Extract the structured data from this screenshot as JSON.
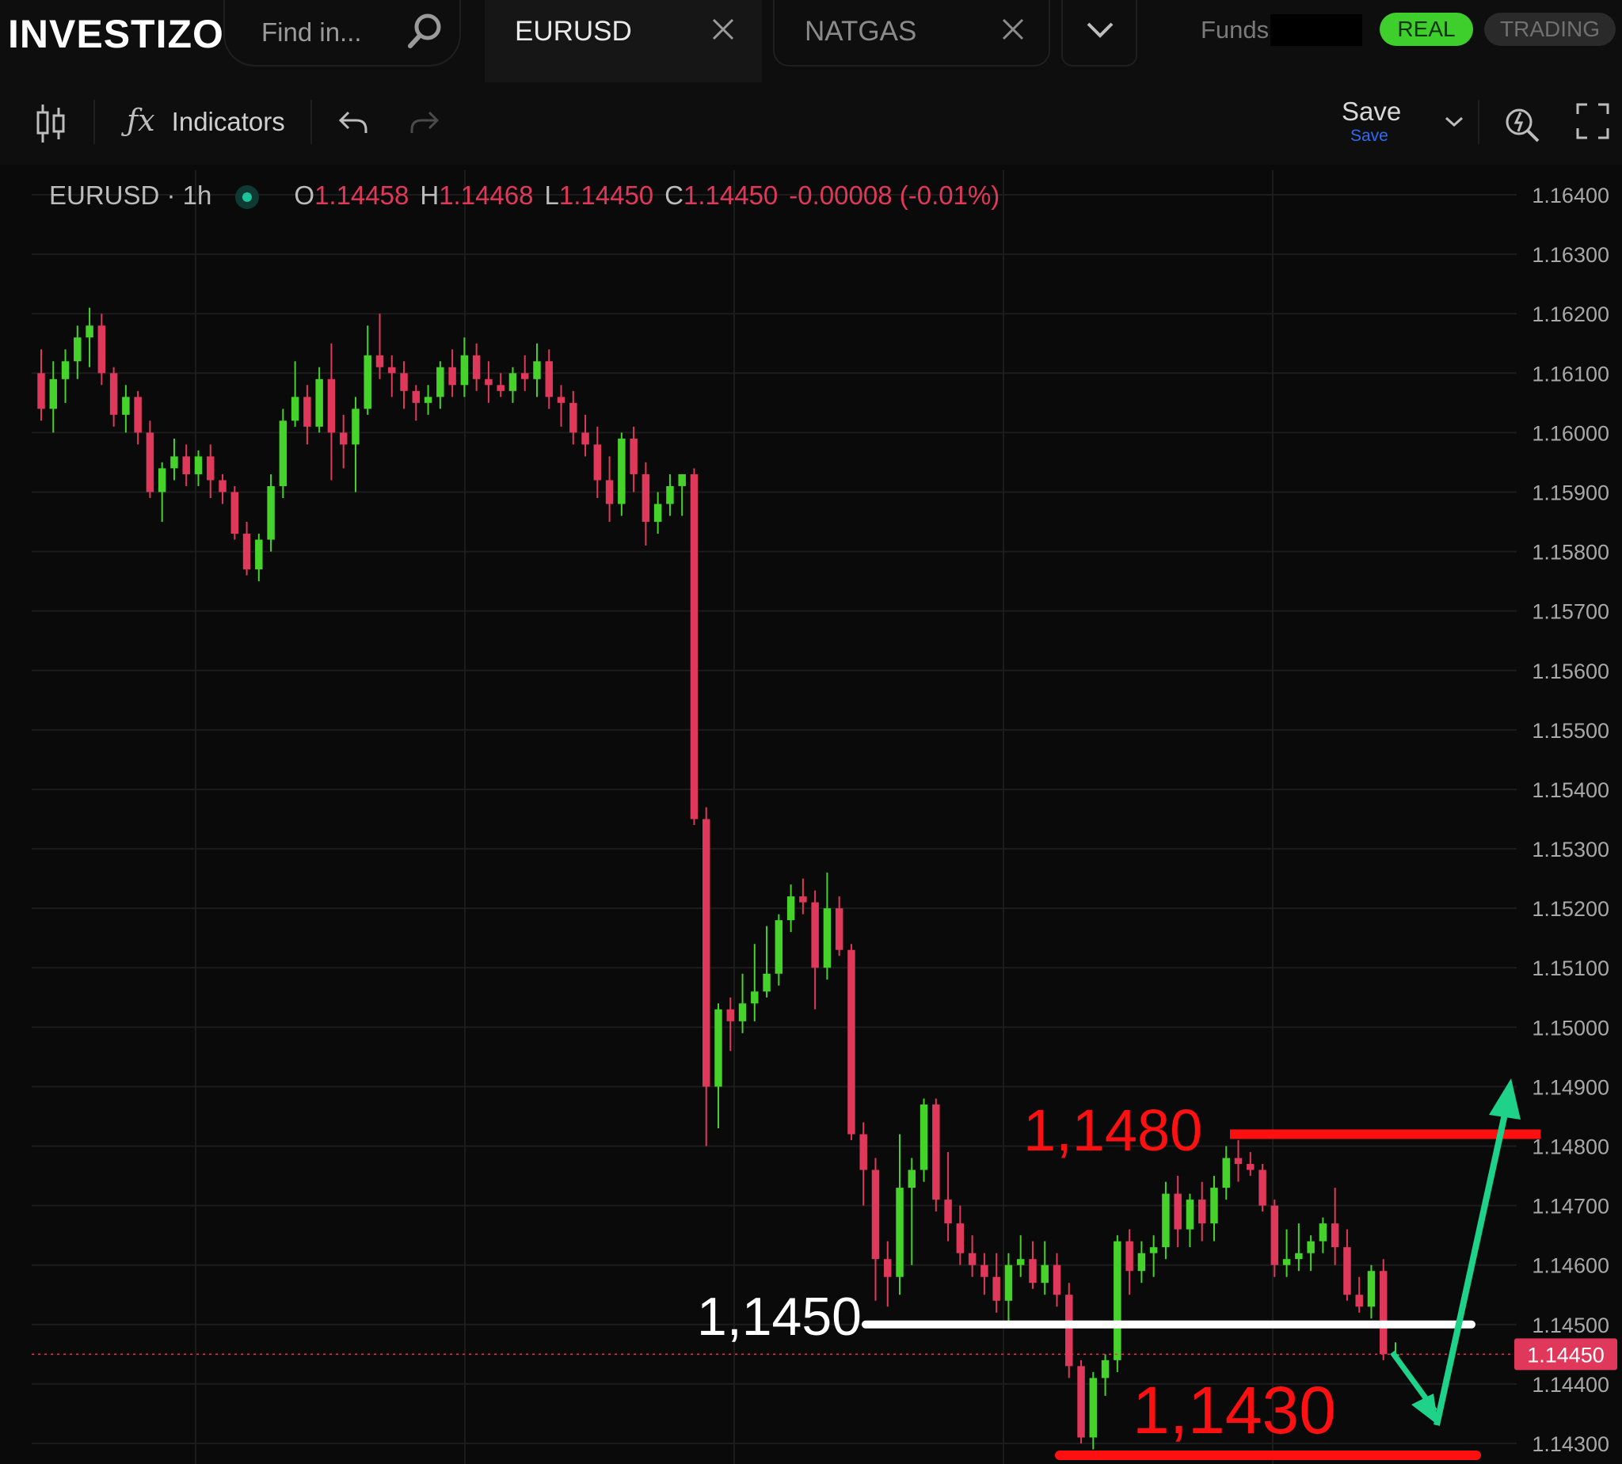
{
  "app": {
    "logo": "INVESTIZO",
    "search_placeholder": "Find in...",
    "tabs": [
      {
        "label": "EURUSD",
        "active": true
      },
      {
        "label": "NATGAS",
        "active": false
      }
    ],
    "funds_label": "Funds:",
    "account_real": "REAL",
    "account_trading": "TRADING"
  },
  "toolbar": {
    "indicators_label": "Indicators",
    "save_label": "Save",
    "save_sublabel": "Save"
  },
  "legend": {
    "symbol": "EURUSD · 1h",
    "o_key": "O",
    "o_val": "1.14458",
    "h_key": "H",
    "h_val": "1.14468",
    "l_key": "L",
    "l_val": "1.14450",
    "c_key": "C",
    "c_val": "1.14450",
    "change": "-0.00008 (-0.01%)"
  },
  "chart_data": {
    "type": "candlestick",
    "symbol": "EURUSD",
    "timeframe": "1h",
    "y_ticks": [
      "1.16400",
      "1.16300",
      "1.16200",
      "1.16100",
      "1.16000",
      "1.15900",
      "1.15800",
      "1.15700",
      "1.15600",
      "1.15500",
      "1.15400",
      "1.15300",
      "1.15200",
      "1.15100",
      "1.15000",
      "1.14900",
      "1.14800",
      "1.14700",
      "1.14600",
      "1.14500",
      "1.14400",
      "1.14300"
    ],
    "ylim": [
      1.1428,
      1.1644
    ],
    "current_price": "1.14450",
    "colors": {
      "up": "#45d22a",
      "down": "#e0385a",
      "annotation_red": "#ff1010",
      "annotation_white": "#ffffff",
      "arrow": "#1fd28a"
    },
    "candles": [
      [
        1.161,
        1.1614,
        1.1602,
        1.1604
      ],
      [
        1.1604,
        1.1612,
        1.16,
        1.1609
      ],
      [
        1.1609,
        1.1614,
        1.1605,
        1.1612
      ],
      [
        1.1612,
        1.1618,
        1.1609,
        1.1616
      ],
      [
        1.1616,
        1.1621,
        1.1611,
        1.1618
      ],
      [
        1.1618,
        1.162,
        1.1608,
        1.161
      ],
      [
        1.161,
        1.1611,
        1.1601,
        1.1603
      ],
      [
        1.1603,
        1.1608,
        1.16,
        1.1606
      ],
      [
        1.1606,
        1.1607,
        1.1598,
        1.16
      ],
      [
        1.16,
        1.1602,
        1.1589,
        1.159
      ],
      [
        1.159,
        1.1595,
        1.1585,
        1.1594
      ],
      [
        1.1594,
        1.1599,
        1.1592,
        1.1596
      ],
      [
        1.1596,
        1.1598,
        1.1591,
        1.1593
      ],
      [
        1.1593,
        1.1597,
        1.1591,
        1.1596
      ],
      [
        1.1596,
        1.1598,
        1.1589,
        1.1592
      ],
      [
        1.1592,
        1.1593,
        1.1588,
        1.159
      ],
      [
        1.159,
        1.1591,
        1.1582,
        1.1583
      ],
      [
        1.1583,
        1.1585,
        1.1576,
        1.1577
      ],
      [
        1.1577,
        1.1583,
        1.1575,
        1.1582
      ],
      [
        1.1582,
        1.1593,
        1.158,
        1.1591
      ],
      [
        1.1591,
        1.1604,
        1.1589,
        1.1602
      ],
      [
        1.1602,
        1.1612,
        1.1601,
        1.1606
      ],
      [
        1.1606,
        1.1608,
        1.1598,
        1.1601
      ],
      [
        1.1601,
        1.1611,
        1.16,
        1.1609
      ],
      [
        1.1609,
        1.1615,
        1.1592,
        1.16
      ],
      [
        1.16,
        1.1603,
        1.1594,
        1.1598
      ],
      [
        1.1598,
        1.1606,
        1.159,
        1.1604
      ],
      [
        1.1604,
        1.1618,
        1.1603,
        1.1613
      ],
      [
        1.1613,
        1.162,
        1.1609,
        1.1611
      ],
      [
        1.1611,
        1.1613,
        1.1606,
        1.161
      ],
      [
        1.161,
        1.1612,
        1.1604,
        1.1607
      ],
      [
        1.1607,
        1.1608,
        1.1602,
        1.1605
      ],
      [
        1.1605,
        1.1608,
        1.1603,
        1.1606
      ],
      [
        1.1606,
        1.1612,
        1.1604,
        1.1611
      ],
      [
        1.1611,
        1.1614,
        1.1606,
        1.1608
      ],
      [
        1.1608,
        1.1616,
        1.1606,
        1.1613
      ],
      [
        1.1613,
        1.1615,
        1.1607,
        1.1609
      ],
      [
        1.1609,
        1.1612,
        1.1605,
        1.1608
      ],
      [
        1.1608,
        1.161,
        1.1606,
        1.1607
      ],
      [
        1.1607,
        1.1611,
        1.1605,
        1.161
      ],
      [
        1.161,
        1.1613,
        1.1607,
        1.1609
      ],
      [
        1.1609,
        1.1615,
        1.1606,
        1.1612
      ],
      [
        1.1612,
        1.1614,
        1.1604,
        1.1606
      ],
      [
        1.1606,
        1.1608,
        1.1601,
        1.1605
      ],
      [
        1.1605,
        1.1607,
        1.1598,
        1.16
      ],
      [
        1.16,
        1.1603,
        1.1596,
        1.1598
      ],
      [
        1.1598,
        1.1601,
        1.1589,
        1.1592
      ],
      [
        1.1592,
        1.1596,
        1.1585,
        1.1588
      ],
      [
        1.1588,
        1.16,
        1.1586,
        1.1599
      ],
      [
        1.1599,
        1.1601,
        1.159,
        1.1593
      ],
      [
        1.1593,
        1.1595,
        1.1581,
        1.1585
      ],
      [
        1.1585,
        1.159,
        1.1583,
        1.1588
      ],
      [
        1.1588,
        1.1593,
        1.1586,
        1.1591
      ],
      [
        1.1591,
        1.1593,
        1.1586,
        1.1593
      ],
      [
        1.1593,
        1.1594,
        1.1534,
        1.1535
      ],
      [
        1.1535,
        1.1537,
        1.148,
        1.149
      ],
      [
        1.149,
        1.1504,
        1.1483,
        1.1503
      ],
      [
        1.1503,
        1.1505,
        1.1496,
        1.1501
      ],
      [
        1.1501,
        1.1509,
        1.1499,
        1.1504
      ],
      [
        1.1504,
        1.1514,
        1.1501,
        1.1506
      ],
      [
        1.1506,
        1.1517,
        1.1505,
        1.1509
      ],
      [
        1.1509,
        1.1519,
        1.1507,
        1.1518
      ],
      [
        1.1518,
        1.1524,
        1.1516,
        1.1522
      ],
      [
        1.1522,
        1.1525,
        1.1519,
        1.1521
      ],
      [
        1.1521,
        1.1523,
        1.1503,
        1.151
      ],
      [
        1.151,
        1.1526,
        1.1508,
        1.152
      ],
      [
        1.152,
        1.1522,
        1.1512,
        1.1513
      ],
      [
        1.1513,
        1.1514,
        1.1481,
        1.1482
      ],
      [
        1.1482,
        1.1484,
        1.147,
        1.1476
      ],
      [
        1.1476,
        1.1478,
        1.1454,
        1.1461
      ],
      [
        1.1461,
        1.1464,
        1.1453,
        1.1458
      ],
      [
        1.1458,
        1.1482,
        1.1455,
        1.1473
      ],
      [
        1.1473,
        1.1478,
        1.146,
        1.1476
      ],
      [
        1.1476,
        1.1488,
        1.1474,
        1.1487
      ],
      [
        1.1487,
        1.1488,
        1.1469,
        1.1471
      ],
      [
        1.1471,
        1.1479,
        1.1464,
        1.1467
      ],
      [
        1.1467,
        1.147,
        1.146,
        1.1462
      ],
      [
        1.1462,
        1.1465,
        1.1458,
        1.146
      ],
      [
        1.146,
        1.1462,
        1.1455,
        1.1458
      ],
      [
        1.1458,
        1.1462,
        1.1452,
        1.1454
      ],
      [
        1.1454,
        1.1462,
        1.145,
        1.146
      ],
      [
        1.146,
        1.1465,
        1.1458,
        1.1461
      ],
      [
        1.1461,
        1.1464,
        1.1456,
        1.1457
      ],
      [
        1.1457,
        1.1464,
        1.1455,
        1.146
      ],
      [
        1.146,
        1.1462,
        1.1453,
        1.1455
      ],
      [
        1.1455,
        1.1457,
        1.1441,
        1.1443
      ],
      [
        1.1443,
        1.1444,
        1.143,
        1.1431
      ],
      [
        1.1431,
        1.1442,
        1.1429,
        1.1441
      ],
      [
        1.1441,
        1.1445,
        1.1438,
        1.1444
      ],
      [
        1.1444,
        1.1465,
        1.1442,
        1.1464
      ],
      [
        1.1464,
        1.1466,
        1.1455,
        1.1459
      ],
      [
        1.1459,
        1.1464,
        1.1457,
        1.1462
      ],
      [
        1.1462,
        1.1465,
        1.1458,
        1.1463
      ],
      [
        1.1463,
        1.1474,
        1.1461,
        1.1472
      ],
      [
        1.1472,
        1.1475,
        1.1463,
        1.1466
      ],
      [
        1.1466,
        1.1472,
        1.1463,
        1.1471
      ],
      [
        1.1471,
        1.1474,
        1.1464,
        1.1467
      ],
      [
        1.1467,
        1.1475,
        1.1464,
        1.1473
      ],
      [
        1.1473,
        1.148,
        1.1471,
        1.1478
      ],
      [
        1.1478,
        1.1481,
        1.1474,
        1.1477
      ],
      [
        1.1477,
        1.1479,
        1.1475,
        1.1476
      ],
      [
        1.1476,
        1.1477,
        1.1469,
        1.147
      ],
      [
        1.147,
        1.1471,
        1.1458,
        1.146
      ],
      [
        1.146,
        1.1466,
        1.1458,
        1.1461
      ],
      [
        1.1461,
        1.1467,
        1.1459,
        1.1462
      ],
      [
        1.1462,
        1.1465,
        1.1459,
        1.1464
      ],
      [
        1.1464,
        1.1468,
        1.1462,
        1.1467
      ],
      [
        1.1467,
        1.1473,
        1.146,
        1.1463
      ],
      [
        1.1463,
        1.1466,
        1.1454,
        1.1455
      ],
      [
        1.1455,
        1.1458,
        1.1452,
        1.1453
      ],
      [
        1.1453,
        1.146,
        1.1451,
        1.1459
      ],
      [
        1.1459,
        1.1461,
        1.1444,
        1.1445
      ],
      [
        1.1445,
        1.1447,
        1.1444,
        1.1445
      ]
    ],
    "annotations": [
      {
        "label": "1,1480",
        "price": 1.1482,
        "color": "red"
      },
      {
        "label": "1,1450",
        "price": 1.145,
        "color": "white"
      },
      {
        "label": "1,1430",
        "price": 1.1428,
        "color": "red"
      }
    ]
  }
}
